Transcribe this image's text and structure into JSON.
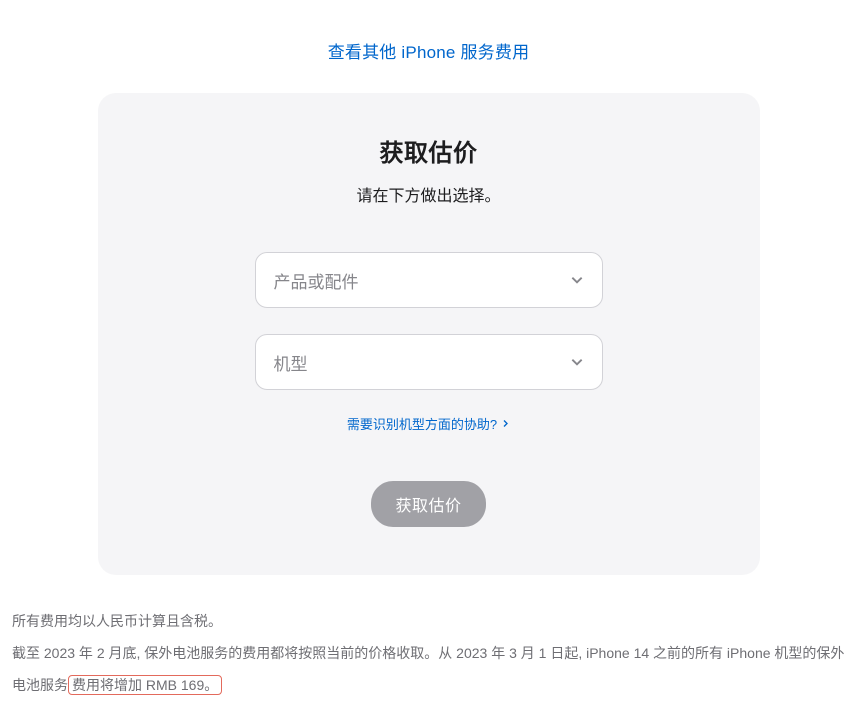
{
  "topLink": {
    "label": "查看其他 iPhone 服务费用"
  },
  "card": {
    "title": "获取估价",
    "subtitle": "请在下方做出选择。",
    "select1": {
      "placeholder": "产品或配件"
    },
    "select2": {
      "placeholder": "机型"
    },
    "helpLink": {
      "label": "需要识别机型方面的协助?"
    },
    "button": {
      "label": "获取估价"
    }
  },
  "footer": {
    "line1": "所有费用均以人民币计算且含税。",
    "line2_part1": "截至 2023 年 2 月底, 保外电池服务的费用都将按照当前的价格收取。从 2023 年 3 月 1 日起, iPhone 14 之前的所有 iPhone 机型的保外电池服务",
    "line2_highlight": "费用将增加 RMB 169。"
  }
}
